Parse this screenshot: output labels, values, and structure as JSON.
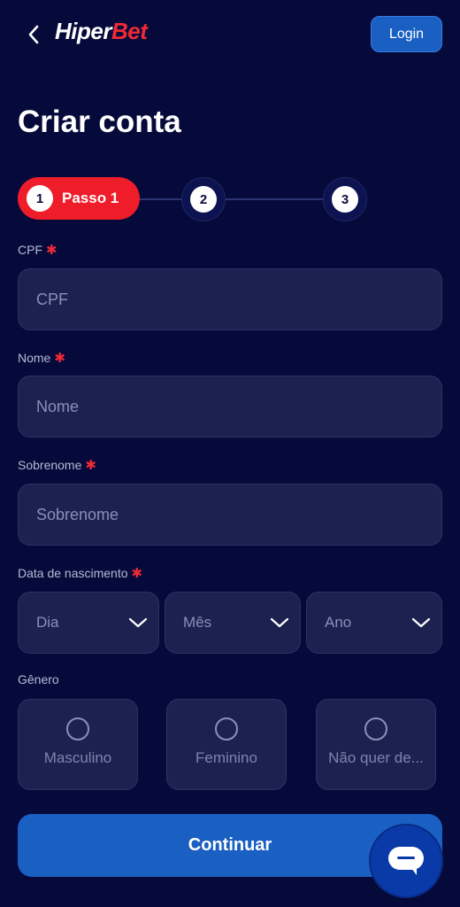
{
  "header": {
    "logo_part1": "Hiper",
    "logo_part2": "Bet",
    "login_label": "Login",
    "back_icon": "chevron-left-icon"
  },
  "page": {
    "title": "Criar conta"
  },
  "stepper": {
    "active": {
      "number": "1",
      "label": "Passo 1"
    },
    "steps": [
      "2",
      "3"
    ]
  },
  "form": {
    "cpf": {
      "label": "CPF",
      "placeholder": "CPF",
      "required": "✱"
    },
    "nome": {
      "label": "Nome",
      "placeholder": "Nome",
      "required": "✱"
    },
    "sobrenome": {
      "label": "Sobrenome",
      "placeholder": "Sobrenome",
      "required": "✱"
    },
    "birth": {
      "label": "Data de nascimento",
      "required": "✱",
      "day": "Dia",
      "month": "Mês",
      "year": "Ano"
    },
    "gender": {
      "label": "Gênero",
      "options": [
        "Masculino",
        "Feminino",
        "Não quer de..."
      ]
    }
  },
  "actions": {
    "continue_label": "Continuar"
  },
  "colors": {
    "background": "#060a3a",
    "accent_blue": "#1a5fc2",
    "accent_red": "#ef1c2a",
    "input_bg": "#1d2150"
  }
}
